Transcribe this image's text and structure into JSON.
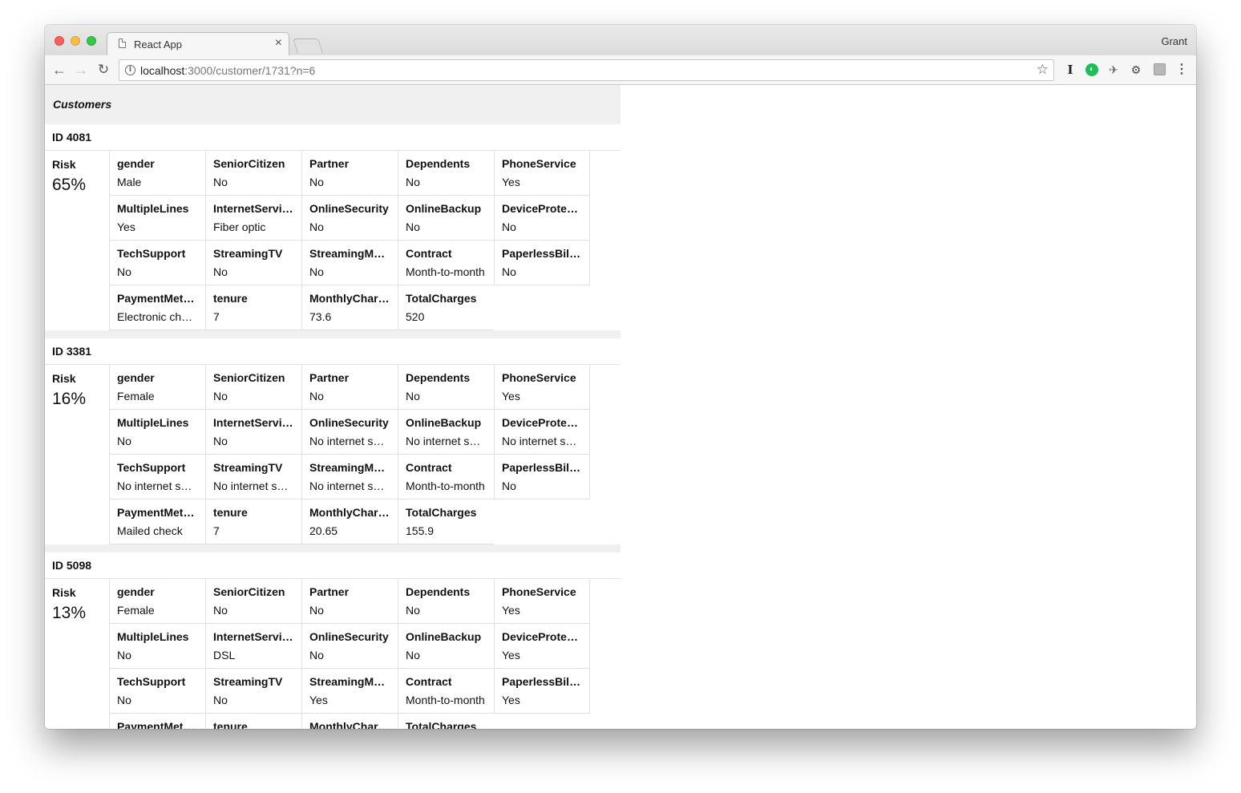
{
  "browser": {
    "tab_title": "React App",
    "tab_close": "×",
    "profile_name": "Grant",
    "url_host": "localhost",
    "url_rest": ":3000/customer/1731?n=6",
    "info_icon": "i",
    "star_icon": "☆",
    "back_icon": "←",
    "forward_icon": "→",
    "reload_icon": "↻",
    "ext_1_icon": "I",
    "ext_2_icon": "◐",
    "ext_3_icon": "✈",
    "ext_4_icon": "⚙",
    "menu_icon": "⋮"
  },
  "app": {
    "header": "Customers",
    "risk_label": "Risk"
  },
  "customers": [
    {
      "id": "ID 4081",
      "risk": "65%",
      "fields": [
        {
          "label": "gender",
          "value": "Male"
        },
        {
          "label": "SeniorCitizen",
          "value": "No"
        },
        {
          "label": "Partner",
          "value": "No"
        },
        {
          "label": "Dependents",
          "value": "No"
        },
        {
          "label": "PhoneService",
          "value": "Yes"
        },
        {
          "label": "MultipleLines",
          "value": "Yes"
        },
        {
          "label": "InternetService",
          "value": "Fiber optic"
        },
        {
          "label": "OnlineSecurity",
          "value": "No"
        },
        {
          "label": "OnlineBackup",
          "value": "No"
        },
        {
          "label": "DeviceProtection",
          "value": "No"
        },
        {
          "label": "TechSupport",
          "value": "No"
        },
        {
          "label": "StreamingTV",
          "value": "No"
        },
        {
          "label": "StreamingMovies",
          "value": "No"
        },
        {
          "label": "Contract",
          "value": "Month-to-month"
        },
        {
          "label": "PaperlessBilling",
          "value": "No"
        },
        {
          "label": "PaymentMethod",
          "value": "Electronic check"
        },
        {
          "label": "tenure",
          "value": "7"
        },
        {
          "label": "MonthlyCharges",
          "value": "73.6"
        },
        {
          "label": "TotalCharges",
          "value": "520"
        }
      ]
    },
    {
      "id": "ID 3381",
      "risk": "16%",
      "fields": [
        {
          "label": "gender",
          "value": "Female"
        },
        {
          "label": "SeniorCitizen",
          "value": "No"
        },
        {
          "label": "Partner",
          "value": "No"
        },
        {
          "label": "Dependents",
          "value": "No"
        },
        {
          "label": "PhoneService",
          "value": "Yes"
        },
        {
          "label": "MultipleLines",
          "value": "No"
        },
        {
          "label": "InternetService",
          "value": "No"
        },
        {
          "label": "OnlineSecurity",
          "value": "No internet service"
        },
        {
          "label": "OnlineBackup",
          "value": "No internet service"
        },
        {
          "label": "DeviceProtection",
          "value": "No internet service"
        },
        {
          "label": "TechSupport",
          "value": "No internet service"
        },
        {
          "label": "StreamingTV",
          "value": "No internet service"
        },
        {
          "label": "StreamingMovies",
          "value": "No internet service"
        },
        {
          "label": "Contract",
          "value": "Month-to-month"
        },
        {
          "label": "PaperlessBilling",
          "value": "No"
        },
        {
          "label": "PaymentMethod",
          "value": "Mailed check"
        },
        {
          "label": "tenure",
          "value": "7"
        },
        {
          "label": "MonthlyCharges",
          "value": "20.65"
        },
        {
          "label": "TotalCharges",
          "value": "155.9"
        }
      ]
    },
    {
      "id": "ID 5098",
      "risk": "13%",
      "fields": [
        {
          "label": "gender",
          "value": "Female"
        },
        {
          "label": "SeniorCitizen",
          "value": "No"
        },
        {
          "label": "Partner",
          "value": "No"
        },
        {
          "label": "Dependents",
          "value": "No"
        },
        {
          "label": "PhoneService",
          "value": "Yes"
        },
        {
          "label": "MultipleLines",
          "value": "No"
        },
        {
          "label": "InternetService",
          "value": "DSL"
        },
        {
          "label": "OnlineSecurity",
          "value": "No"
        },
        {
          "label": "OnlineBackup",
          "value": "No"
        },
        {
          "label": "DeviceProtection",
          "value": "Yes"
        },
        {
          "label": "TechSupport",
          "value": "No"
        },
        {
          "label": "StreamingTV",
          "value": "No"
        },
        {
          "label": "StreamingMovies",
          "value": "Yes"
        },
        {
          "label": "Contract",
          "value": "Month-to-month"
        },
        {
          "label": "PaperlessBilling",
          "value": "Yes"
        },
        {
          "label": "PaymentMethod",
          "value": ""
        },
        {
          "label": "tenure",
          "value": ""
        },
        {
          "label": "MonthlyCharges",
          "value": ""
        },
        {
          "label": "TotalCharges",
          "value": ""
        }
      ]
    }
  ]
}
